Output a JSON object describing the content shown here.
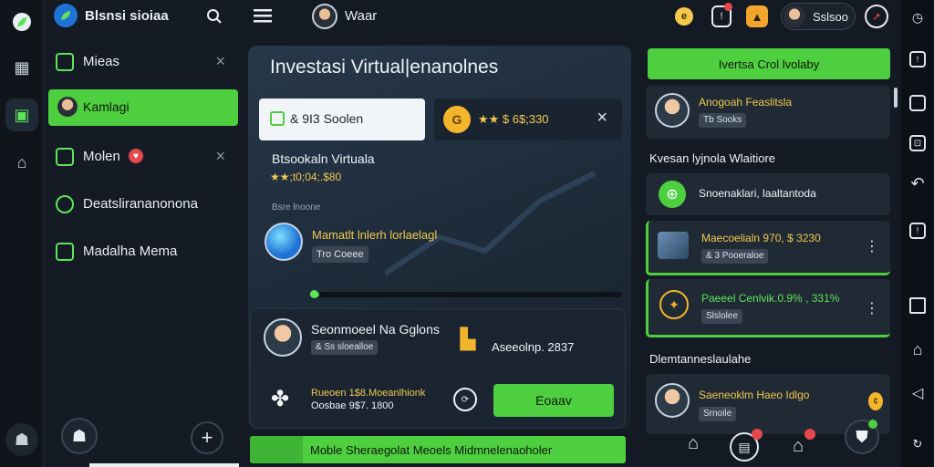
{
  "app": {
    "title": "Blsnsi sioiaa"
  },
  "header": {
    "menu_label": "Waar",
    "balance_label": "Sslsoo"
  },
  "sidebar": {
    "items": [
      {
        "label": "Mieas",
        "closable": true
      },
      {
        "label": "Kamlagi",
        "active": true
      },
      {
        "label": "Molen",
        "closable": true
      },
      {
        "label": "Deatslirananonona"
      },
      {
        "label": "Madalha Mema"
      }
    ]
  },
  "main": {
    "title": "Investasi Virtual|enanolnes",
    "search": {
      "value": "& 9I3 Soolen"
    },
    "reward": {
      "value": "★★ $ 6$;330"
    },
    "section_title": "Btsookaln Virtuala",
    "rating_text": "★★;t0;04;.$80",
    "small_label": "Bsre lnoone",
    "featured": {
      "title": "Mamatlt lnlerh lorlaelagl",
      "chip": "Tro Coeee",
      "progress": 0.03
    },
    "profile": {
      "name": "Seonmoeel Na Gglons",
      "chip": "& Ss sloealloe",
      "amount": "Aseeolnp. 2837"
    },
    "offer": {
      "line1": "Rueoen 1$8.Moeanlhionk",
      "line2": "Oosbae 9$7. 1800",
      "button": "Eoaav"
    }
  },
  "right": {
    "cta": "Ivertsa Crol lvolaby",
    "cards": [
      {
        "title": "Anogoah Feaslitsla",
        "chip": "Tb Sooks"
      },
      {
        "section": "Kvesan lyjnola Wlaitiore"
      },
      {
        "title": "Snoenaklari, laaltantoda"
      },
      {
        "title": "Maecoelialn 970, $ 3230",
        "chip": "& 3 Pooeraloe"
      },
      {
        "title": "Paeeel Cenlvik.0.9% , 331%",
        "chip": "Slslolee"
      },
      {
        "section": "Dlemtanneslaulahe"
      },
      {
        "title": "Saeneoklm Haeo Idlgo",
        "chip": "Srnoile"
      }
    ]
  },
  "footer": {
    "text": "Moble Sheraegolat Meoels Midmnelenaoholer"
  },
  "colors": {
    "accent": "#5ee35a",
    "background": "#141a23",
    "warning": "#f2c94c",
    "badge": "#e5484d"
  },
  "icons": [
    "leaf-icon",
    "search-icon",
    "menu-icon",
    "gear-icon",
    "close-icon",
    "coin-icon",
    "notification-icon",
    "shield-icon",
    "back-icon",
    "home-icon"
  ]
}
